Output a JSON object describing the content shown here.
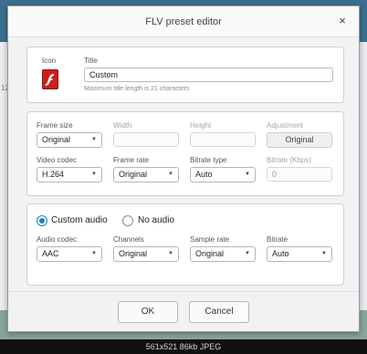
{
  "background": {
    "side_number": "12"
  },
  "dialog": {
    "title": "FLV preset editor",
    "close_glyph": "×",
    "icon_label": "Icon",
    "title_label": "Title",
    "title_value": "Custom",
    "title_hint": "Maximum title length is 21 characters",
    "video": {
      "frame_size": {
        "label": "Frame size",
        "value": "Original"
      },
      "width": {
        "label": "Width",
        "value": ""
      },
      "height": {
        "label": "Height",
        "value": ""
      },
      "adjustment": {
        "label": "Adjustment",
        "value": "Original"
      },
      "video_codec": {
        "label": "Video codec",
        "value": "H.264"
      },
      "frame_rate": {
        "label": "Frame rate",
        "value": "Original"
      },
      "bitrate_type": {
        "label": "Bitrate type",
        "value": "Auto"
      },
      "bitrate_kbps": {
        "label": "Bitrate (Kbps)",
        "value": "0"
      }
    },
    "audio": {
      "custom_audio_label": "Custom audio",
      "no_audio_label": "No audio",
      "audio_codec": {
        "label": "Audio codec",
        "value": "AAC"
      },
      "channels": {
        "label": "Channels",
        "value": "Original"
      },
      "sample_rate": {
        "label": "Sample rate",
        "value": "Original"
      },
      "bitrate": {
        "label": "Bitrate",
        "value": "Auto"
      }
    },
    "ok_label": "OK",
    "cancel_label": "Cancel"
  },
  "status_text": "561x521 86kb JPEG",
  "colors": {
    "accent": "#1b7fbd",
    "flash_red": "#c8211a"
  },
  "icons": {
    "dropdown": "chevron-down-icon",
    "close": "close-icon",
    "app": "flash-player-icon"
  }
}
